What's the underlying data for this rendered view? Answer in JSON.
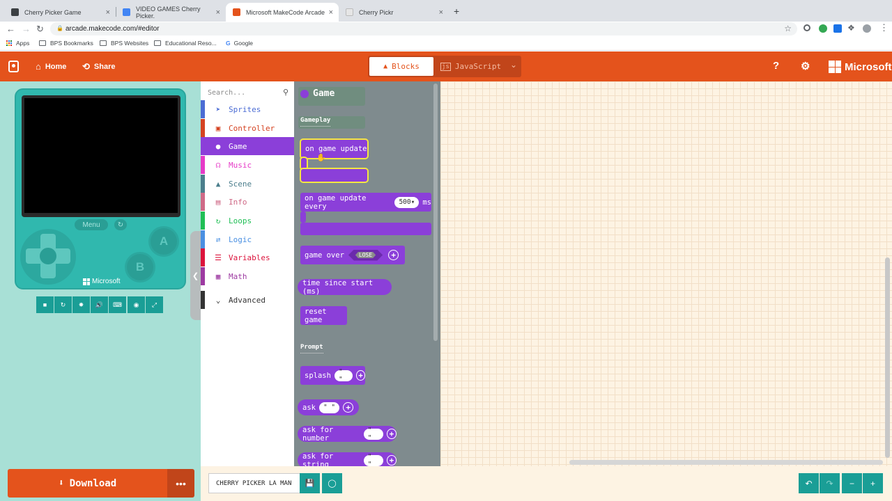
{
  "browser": {
    "tabs": [
      {
        "title": "Cherry Picker Game",
        "color": "#3c4043"
      },
      {
        "title": "VIDEO GAMES Cherry Picker.",
        "color": "#4285f4"
      },
      {
        "title": "Microsoft MakeCode Arcade",
        "color": "#e4531c"
      },
      {
        "title": "Cherry Pickr",
        "color": "#e6e6e6"
      }
    ],
    "close_glyph": "×",
    "new_tab_glyph": "+",
    "url": "arcade.makecode.com/#editor",
    "bookmarks": [
      "Apps",
      "BPS Bookmarks",
      "BPS Websites",
      "Educational Reso...",
      "Google"
    ]
  },
  "header": {
    "home_label": "Home",
    "share_label": "Share",
    "blocks_label": "Blocks",
    "javascript_label": "JavaScript",
    "brand": "Microsoft",
    "accent": "#e4531c"
  },
  "simulator": {
    "menu_label": "Menu",
    "a_label": "A",
    "b_label": "B",
    "brand": "Microsoft",
    "download_label": "Download",
    "more_label": "•••"
  },
  "toolbox": {
    "search_placeholder": "Search...",
    "categories": [
      {
        "label": "Sprites",
        "color": "#4b6cd4",
        "icon": "paper-plane-icon"
      },
      {
        "label": "Controller",
        "color": "#d54322",
        "icon": "gamepad-icon"
      },
      {
        "label": "Game",
        "color": "#8b3fd9",
        "icon": "circle-icon"
      },
      {
        "label": "Music",
        "color": "#e63ac7",
        "icon": "headphones-icon"
      },
      {
        "label": "Scene",
        "color": "#4b7e8c",
        "icon": "tree-icon"
      },
      {
        "label": "Info",
        "color": "#cf6a87",
        "icon": "id-card-icon"
      },
      {
        "label": "Loops",
        "color": "#20bf55",
        "icon": "loop-icon"
      },
      {
        "label": "Logic",
        "color": "#4a90e2",
        "icon": "shuffle-icon"
      },
      {
        "label": "Variables",
        "color": "#dc143c",
        "icon": "list-icon"
      },
      {
        "label": "Math",
        "color": "#9d3aa1",
        "icon": "calculator-icon"
      }
    ],
    "advanced_label": "Advanced"
  },
  "flyout": {
    "title": "Game",
    "section_gameplay": "Gameplay",
    "section_prompt": "Prompt",
    "on_game_update": "on game update",
    "on_game_update_every": "on game update every",
    "every_value": "500",
    "every_unit": "ms",
    "game_over": "game over",
    "game_over_value": "LOSE",
    "time_since_start": "time since start (ms)",
    "reset_game": "reset game",
    "splash": "splash",
    "ask": "ask",
    "ask_for_number": "ask for number",
    "ask_for_string": "ask for string",
    "empty_string": "\" \""
  },
  "bottom": {
    "project_name": "CHERRY PICKER LA MAN"
  }
}
